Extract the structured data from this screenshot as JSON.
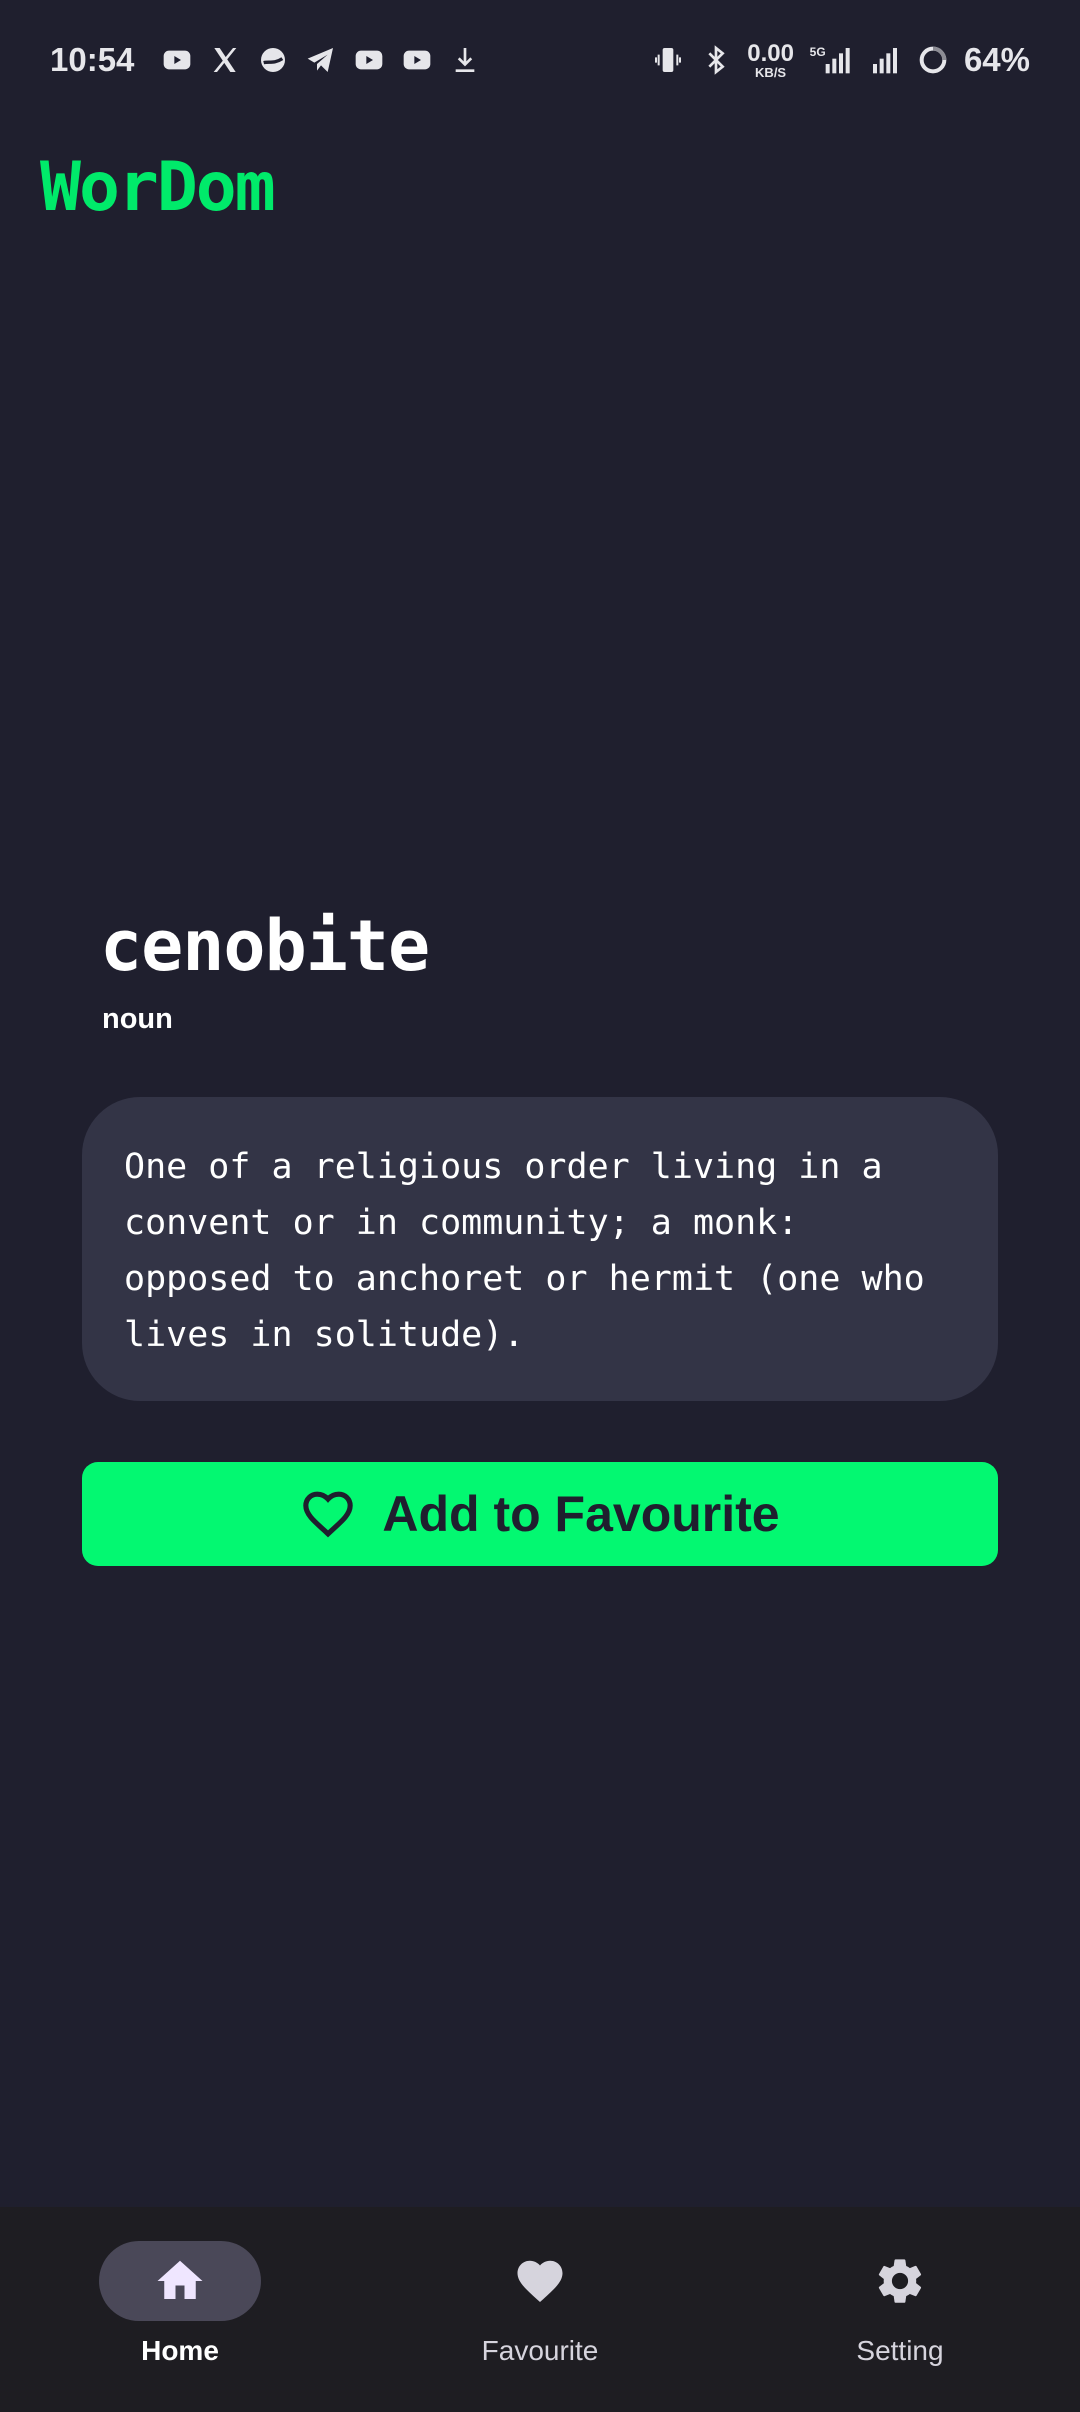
{
  "status_bar": {
    "time": "10:54",
    "net_speed_value": "0.00",
    "net_speed_unit": "KB/S",
    "network_type": "5G",
    "battery": "64%",
    "notification_icons": [
      "youtube-icon",
      "x-icon",
      "chrome-like-icon",
      "telegram-icon",
      "youtube-icon",
      "youtube-icon",
      "download-icon"
    ],
    "system_icons": [
      "vibrate-icon",
      "bluetooth-icon",
      "signal-5g-icon",
      "signal-icon",
      "battery-saver-icon"
    ]
  },
  "app": {
    "title": "WorDom",
    "accent_color": "#00ea6a"
  },
  "entry": {
    "word": "cenobite",
    "part_of_speech": "noun",
    "definition": "One of a religious order living in a convent or in community; a monk: opposed to anchoret or hermit (one who lives in solitude)."
  },
  "actions": {
    "add_favourite_label": "Add to Favourite",
    "add_favourite_icon": "heart-outline-icon"
  },
  "bottom_nav": {
    "items": [
      {
        "label": "Home",
        "icon": "home-icon",
        "active": true
      },
      {
        "label": "Favourite",
        "icon": "heart-icon",
        "active": false
      },
      {
        "label": "Setting",
        "icon": "gear-icon",
        "active": false
      }
    ]
  }
}
